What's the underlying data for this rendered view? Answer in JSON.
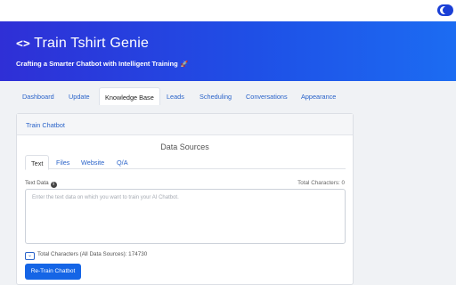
{
  "header": {
    "title": "Train Tshirt Genie",
    "subtitle": "Crafting a Smarter Chatbot with Intelligent Training",
    "title_icon": "code-icon",
    "subtitle_icon": "rocket-icon",
    "gradient_start": "#2f2fd6",
    "gradient_end": "#1c6cf2"
  },
  "nav": {
    "tabs": [
      {
        "label": "Dashboard"
      },
      {
        "label": "Update"
      },
      {
        "label": "Knowledge Base"
      },
      {
        "label": "Leads"
      },
      {
        "label": "Scheduling"
      },
      {
        "label": "Conversations"
      },
      {
        "label": "Appearance"
      }
    ],
    "active": "Knowledge Base"
  },
  "panel": {
    "header_label": "Train Chatbot",
    "section_title": "Data Sources",
    "source_tabs": [
      {
        "label": "Text"
      },
      {
        "label": "Files"
      },
      {
        "label": "Website"
      },
      {
        "label": "Q/A"
      }
    ],
    "active_source": "Text",
    "text_data_label": "Text Data",
    "total_characters": "Total Characters: 0",
    "textarea_placeholder": "Enter the text data on which you want to train your AI Chatbot.",
    "textarea_value": "",
    "total_all_sources": "Total Characters (All Data Sources): 174730",
    "retrain_button": "Re-Train Chatbot"
  },
  "colors": {
    "accent": "#1565e6",
    "link": "#2a63c9"
  }
}
